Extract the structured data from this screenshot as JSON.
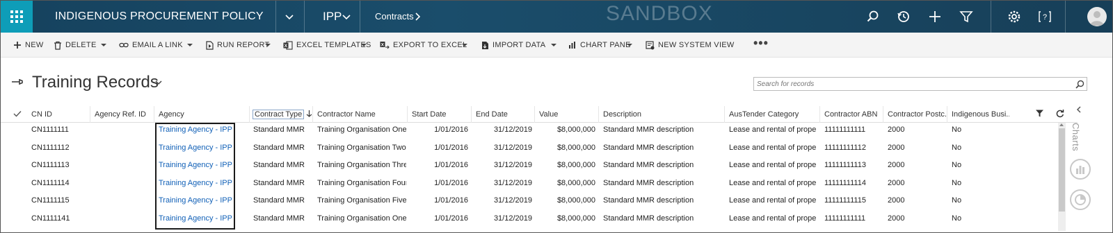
{
  "topnav": {
    "app_title": "INDIGENOUS PROCUREMENT POLICY",
    "area": "IPP",
    "entity": "Contracts",
    "environment": "SANDBOX",
    "icons": [
      "waffle-icon",
      "search-icon",
      "history-icon",
      "plus-icon",
      "filter-icon",
      "gear-icon",
      "help-icon",
      "user-icon"
    ]
  },
  "commands": {
    "new": "NEW",
    "delete": "DELETE",
    "email_link": "EMAIL A LINK",
    "run_report": "RUN REPORT",
    "excel_templates": "EXCEL TEMPLATES",
    "export_excel": "EXPORT TO EXCEL",
    "import_data": "IMPORT DATA",
    "chart_pane": "CHART PANE",
    "new_system_view": "NEW SYSTEM VIEW",
    "more": "•••"
  },
  "view": {
    "title": "Training Records",
    "search_placeholder": "Search for records"
  },
  "grid": {
    "columns": [
      "CN ID",
      "Agency Ref. ID",
      "Agency",
      "Contract Type",
      "Contractor Name",
      "Start Date",
      "End Date",
      "Value",
      "Description",
      "AusTender Category",
      "Contractor ABN",
      "Contractor Postc...",
      "Indigenous Busi..."
    ],
    "sorted_column": "Contract Type",
    "rows": [
      {
        "cn_id": "CN1111111",
        "agency_ref": "",
        "agency": "Training Agency - IPP",
        "contract_type": "Standard MMR",
        "contractor": "Training Organisation One",
        "start": "1/01/2016",
        "end": "31/12/2019",
        "value": "$8,000,000",
        "description": "Standard MMR description",
        "category": "Lease and rental of proper...",
        "abn": "11111111111",
        "postcode": "2000",
        "indigenous": "No"
      },
      {
        "cn_id": "CN1111112",
        "agency_ref": "",
        "agency": "Training Agency - IPP",
        "contract_type": "Standard MMR",
        "contractor": "Training Organisation Two",
        "start": "1/01/2016",
        "end": "31/12/2019",
        "value": "$8,000,000",
        "description": "Standard MMR description",
        "category": "Lease and rental of proper...",
        "abn": "11111111112",
        "postcode": "2000",
        "indigenous": "No"
      },
      {
        "cn_id": "CN1111113",
        "agency_ref": "",
        "agency": "Training Agency - IPP",
        "contract_type": "Standard MMR",
        "contractor": "Training Organisation Three",
        "start": "1/01/2016",
        "end": "31/12/2019",
        "value": "$8,000,000",
        "description": "Standard MMR description",
        "category": "Lease and rental of proper...",
        "abn": "11111111113",
        "postcode": "2000",
        "indigenous": "No"
      },
      {
        "cn_id": "CN1111114",
        "agency_ref": "",
        "agency": "Training Agency - IPP",
        "contract_type": "Standard MMR",
        "contractor": "Training Organisation Four",
        "start": "1/01/2016",
        "end": "31/12/2019",
        "value": "$8,000,000",
        "description": "Standard MMR description",
        "category": "Lease and rental of proper...",
        "abn": "11111111114",
        "postcode": "2000",
        "indigenous": "No"
      },
      {
        "cn_id": "CN1111115",
        "agency_ref": "",
        "agency": "Training Agency - IPP",
        "contract_type": "Standard MMR",
        "contractor": "Training Organisation Five",
        "start": "1/01/2016",
        "end": "31/12/2019",
        "value": "$8,000,000",
        "description": "Standard MMR description",
        "category": "Lease and rental of proper...",
        "abn": "11111111115",
        "postcode": "2000",
        "indigenous": "No"
      },
      {
        "cn_id": "CN1111141",
        "agency_ref": "",
        "agency": "Training Agency - IPP",
        "contract_type": "Standard MMR",
        "contractor": "Training Organisation One",
        "start": "1/01/2016",
        "end": "31/12/2019",
        "value": "$8,000,000",
        "description": "Standard MMR description",
        "category": "Lease and rental of proper...",
        "abn": "11111111111",
        "postcode": "2000",
        "indigenous": "No"
      }
    ]
  },
  "side": {
    "charts_label": "Charts"
  }
}
